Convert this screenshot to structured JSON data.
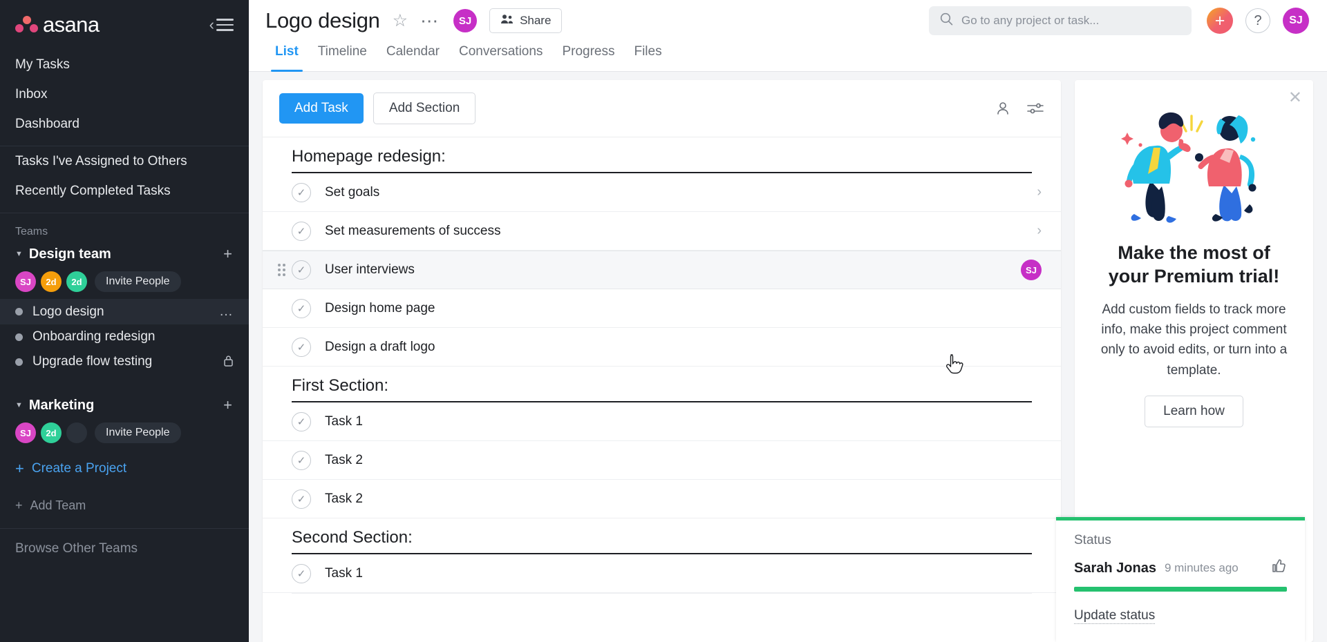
{
  "sidebar": {
    "brand": "asana",
    "collapse_icon": "chevron-left-icon",
    "nav": [
      {
        "label": "My Tasks"
      },
      {
        "label": "Inbox"
      },
      {
        "label": "Dashboard"
      },
      {
        "label": "Tasks I've Assigned to Others"
      },
      {
        "label": "Recently Completed Tasks"
      }
    ],
    "teams_label": "Teams",
    "teams": [
      {
        "name": "Design team",
        "avatars": [
          {
            "initials": "SJ",
            "color": "#d946c4"
          },
          {
            "initials": "2d",
            "color": "#f59e0b"
          },
          {
            "initials": "2d",
            "color": "#2fd099"
          }
        ],
        "invite_label": "Invite People",
        "projects": [
          {
            "name": "Logo design",
            "active": true,
            "dot": "#9aa0aa",
            "menu": "…"
          },
          {
            "name": "Onboarding redesign",
            "active": false,
            "dot": "#9aa0aa"
          },
          {
            "name": "Upgrade flow testing",
            "active": false,
            "dot": "#9aa0aa",
            "locked": true
          }
        ]
      },
      {
        "name": "Marketing",
        "avatars": [
          {
            "initials": "SJ",
            "color": "#d946c4"
          },
          {
            "initials": "2d",
            "color": "#2fd099"
          },
          {
            "initials": "",
            "color": "#2b313a"
          }
        ],
        "invite_label": "Invite People",
        "projects": []
      }
    ],
    "create_project": "Create a Project",
    "add_team": "Add Team",
    "browse_other_teams": "Browse Other Teams"
  },
  "header": {
    "project_title": "Logo design",
    "avatar": {
      "initials": "SJ",
      "color": "#c62fc6"
    },
    "share_label": "Share",
    "tabs": [
      {
        "label": "List",
        "active": true
      },
      {
        "label": "Timeline",
        "active": false
      },
      {
        "label": "Calendar",
        "active": false
      },
      {
        "label": "Conversations",
        "active": false
      },
      {
        "label": "Progress",
        "active": false
      },
      {
        "label": "Files",
        "active": false
      }
    ],
    "search": {
      "placeholder": "Go to any project or task...",
      "value": ""
    },
    "plus_label": "+",
    "help_label": "?",
    "user_avatar": {
      "initials": "SJ",
      "color": "#c62fc6"
    }
  },
  "toolbar": {
    "add_task_label": "Add Task",
    "add_section_label": "Add Section",
    "assignee_icon": "person-icon",
    "filter_icon": "sort-filter-icon"
  },
  "list": {
    "sections": [
      {
        "title": "Homepage redesign:",
        "tasks": [
          {
            "name": "Set goals",
            "chevron": true,
            "assignee": null
          },
          {
            "name": "Set measurements of success",
            "chevron": true,
            "assignee": null
          },
          {
            "name": "User interviews",
            "chevron": false,
            "hovered": true,
            "assignee": {
              "initials": "SJ",
              "color": "#c62fc6"
            }
          },
          {
            "name": "Design home page",
            "chevron": false,
            "assignee": null
          },
          {
            "name": "Design a draft logo",
            "chevron": false,
            "assignee": null
          }
        ]
      },
      {
        "title": "First Section:",
        "tasks": [
          {
            "name": "Task 1",
            "chevron": false,
            "assignee": null
          },
          {
            "name": "Task 2",
            "chevron": false,
            "assignee": null
          },
          {
            "name": "Task 2",
            "chevron": false,
            "assignee": null
          }
        ]
      },
      {
        "title": "Second Section:",
        "tasks": [
          {
            "name": "Task 1",
            "chevron": false,
            "assignee": null
          }
        ]
      }
    ]
  },
  "promo": {
    "close_icon": "close-icon",
    "illustration": "two-people-high-five-illustration",
    "title_line1": "Make the most of",
    "title_line2": "your Premium trial!",
    "body": "Add custom fields to track more info, make this project comment only to avoid edits, or turn into a template.",
    "learn_label": "Learn how"
  },
  "status": {
    "label": "Status",
    "author": "Sarah Jonas",
    "time": "9 minutes ago",
    "thumb_icon": "thumbs-up-icon",
    "bar_color": "#25c16f",
    "update_label": "Update status"
  }
}
